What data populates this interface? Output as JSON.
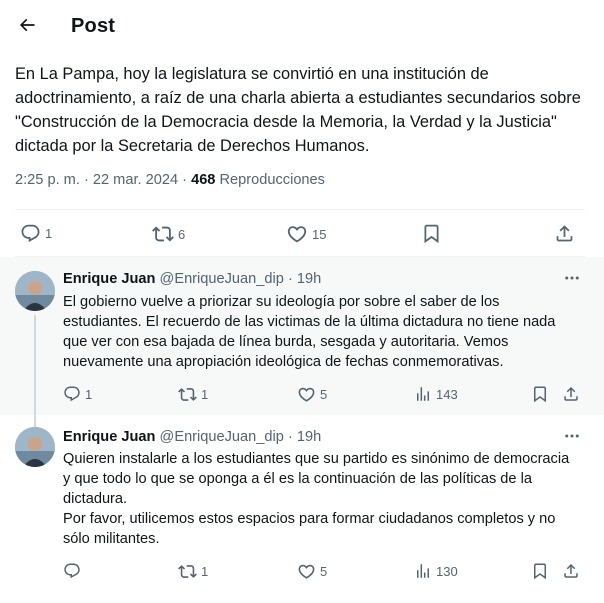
{
  "header": {
    "title": "Post",
    "back_icon": "arrow-left-icon"
  },
  "post": {
    "text": "En La Pampa, hoy la legislatura se convirtió en una institución de adoctrinamiento, a raíz de una charla abierta a estudiantes secundarios sobre \"Construcción de la Democracia desde la Memoria, la Verdad y la Justicia\" dictada por la Secretaria de Derechos Humanos.",
    "time": "2:25 p. m.",
    "separator": " · ",
    "date": "22 mar. 2024",
    "views_count": "468",
    "views_label": "Reproducciones",
    "actions": {
      "replies": "1",
      "reposts": "6",
      "likes": "15"
    }
  },
  "replies": [
    {
      "name": "Enrique Juan",
      "handle": "@EnriqueJuan_dip",
      "dot": "·",
      "time": "19h",
      "text": "El gobierno vuelve a priorizar su ideología por sobre el saber de los estudiantes. El recuerdo de las victimas de la última dictadura no tiene nada que ver con esa bajada de línea burda, sesgada y autoritaria. Vemos nuevamente una apropiación ideológica de fechas conmemorativas.",
      "replies": "1",
      "reposts": "1",
      "likes": "5",
      "views": "143"
    },
    {
      "name": "Enrique Juan",
      "handle": "@EnriqueJuan_dip",
      "dot": "·",
      "time": "19h",
      "text": "Quieren instalarle a los estudiantes que su partido es sinónimo de democracia y que todo lo que se oponga a él es la continuación de las políticas de la dictadura.\nPor favor, utilicemos estos espacios para formar ciudadanos completos y no sólo militantes.",
      "replies": "",
      "reposts": "1",
      "likes": "5",
      "views": "130"
    }
  ],
  "colors": {
    "text": "#0f1419",
    "secondary": "#536471",
    "divider": "#eff3f4",
    "thread_line": "#cfd9de",
    "reply_highlight": "#f7f9f9"
  },
  "icons": [
    "arrow-left-icon",
    "reply-icon",
    "repost-icon",
    "like-icon",
    "bookmark-icon",
    "share-icon",
    "views-icon",
    "more-icon"
  ]
}
